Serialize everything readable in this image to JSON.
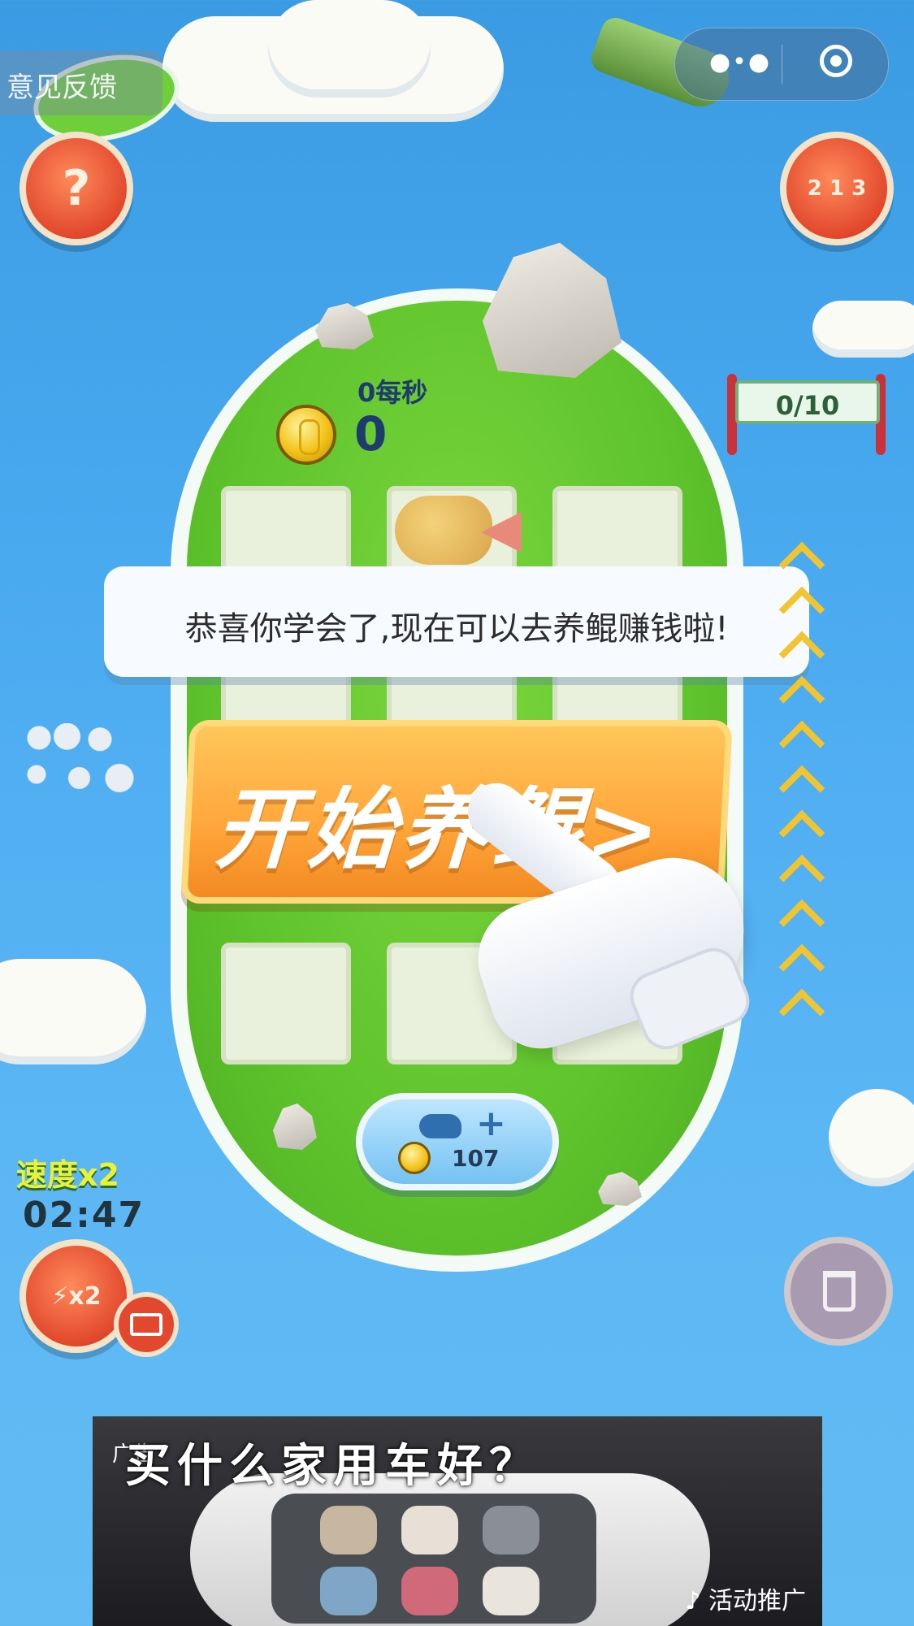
{
  "top_bar": {
    "feedback_label": "意见反馈",
    "menu_icon": "more-dots-icon",
    "close_icon": "target-icon"
  },
  "buttons": {
    "help_glyph": "?",
    "rank_glyph": "2 1 3",
    "boost_glyph": "⚡x2",
    "trash_icon": "trash-icon",
    "video_icon": "video-icon"
  },
  "score": {
    "per_second": "0每秒",
    "coins": "0"
  },
  "progress": {
    "label": "0/10",
    "current": 0,
    "total": 10
  },
  "tutorial": {
    "message": "恭喜你学会了,现在可以去养鲲赚钱啦!",
    "start_label": "开始养鲲>"
  },
  "buy": {
    "price": "107",
    "plus": "+"
  },
  "speed": {
    "label": "速度x2",
    "timer": "02:47"
  },
  "ad": {
    "tag": "广告",
    "headline": "买什么家用车好？",
    "promo": "♪ 活动推广"
  },
  "colors": {
    "sky": "#4aaaf0",
    "grass": "#5fc42d",
    "accent_orange": "#ffa53a",
    "red_button": "#e2482d",
    "chevron": "#f0c531"
  }
}
